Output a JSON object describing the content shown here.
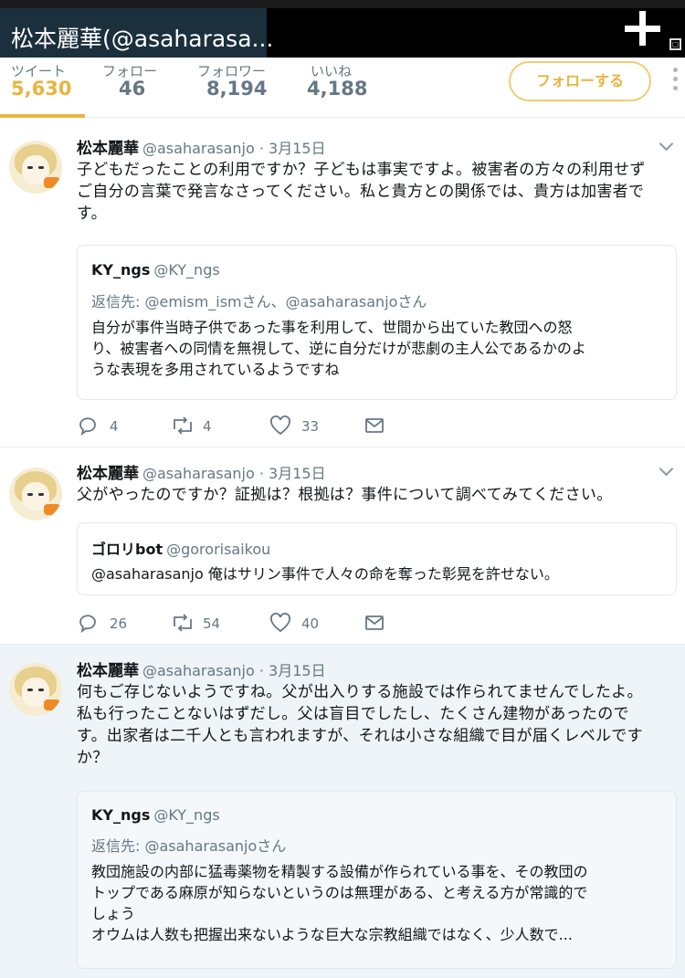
{
  "header": {
    "title": "松本麗華(@asaharasa..."
  },
  "stats": [
    {
      "label": "ツイート",
      "value": "5,630",
      "active": true
    },
    {
      "label": "フォロー",
      "value": "46"
    },
    {
      "label": "フォロワー",
      "value": "8,194"
    },
    {
      "label": "いいね",
      "value": "4,188"
    }
  ],
  "follow_button": "フォローする",
  "colors": {
    "accent": "#e9b43f",
    "text": "#14171a",
    "muted": "#657786"
  },
  "tweets": [
    {
      "name": "松本麗華",
      "handle": "@asaharasanjo · 3月15日",
      "lines": [
        "子どもだったことの利用ですか？子どもは事実ですよ。被害者の方々の利用せず",
        "ご自分の言葉で発言なさってください。私と貴方との関係では、貴方は加害者で",
        "す。"
      ],
      "quote": {
        "name": "KY_ngs",
        "handle": "@KY_ngs",
        "reply": "返信先: @emism_ismさん、@asaharasanjoさん",
        "lines": [
          "自分が事件当時子供であった事を利用して、世間から出ていた教団への怒",
          "り、被害者への同情を無視して、逆に自分だけが悲劇の主人公であるかのよ",
          "うな表現を多用されているようですね"
        ]
      },
      "replies": "4",
      "retweets": "4",
      "likes": "33"
    },
    {
      "name": "松本麗華",
      "handle": "@asaharasanjo · 3月15日",
      "lines": [
        "父がやったのですか？証拠は？根拠は？事件について調べてみてください。"
      ],
      "quote": {
        "name": "ゴロリbot",
        "handle": "@gororisaikou",
        "lines": [
          "@asaharasanjo 俺はサリン事件で人々の命を奪った彰晃を許せない。"
        ]
      },
      "replies": "26",
      "retweets": "54",
      "likes": "40"
    },
    {
      "name": "松本麗華",
      "handle": "@asaharasanjo · 3月15日",
      "lines": [
        "何もご存じないようですね。父が出入りする施設では作られてませんでしたよ。",
        "私も行ったことないはずだし。父は盲目でしたし、たくさん建物があったので",
        "す。出家者は二千人とも言われますが、それは小さな組織で目が届くレベルです",
        "か？"
      ],
      "quote": {
        "name": "KY_ngs",
        "handle": "@KY_ngs",
        "reply": "返信先: @asaharasanjoさん",
        "lines": [
          "教団施設の内部に猛毒薬物を精製する設備が作られている事を、その教団の",
          "トップである麻原が知らないというのは無理がある、と考える方が常識的で",
          "しょう",
          "オウムは人数も把握出来ないような巨大な宗教組織ではなく、少人数で..."
        ]
      }
    }
  ]
}
